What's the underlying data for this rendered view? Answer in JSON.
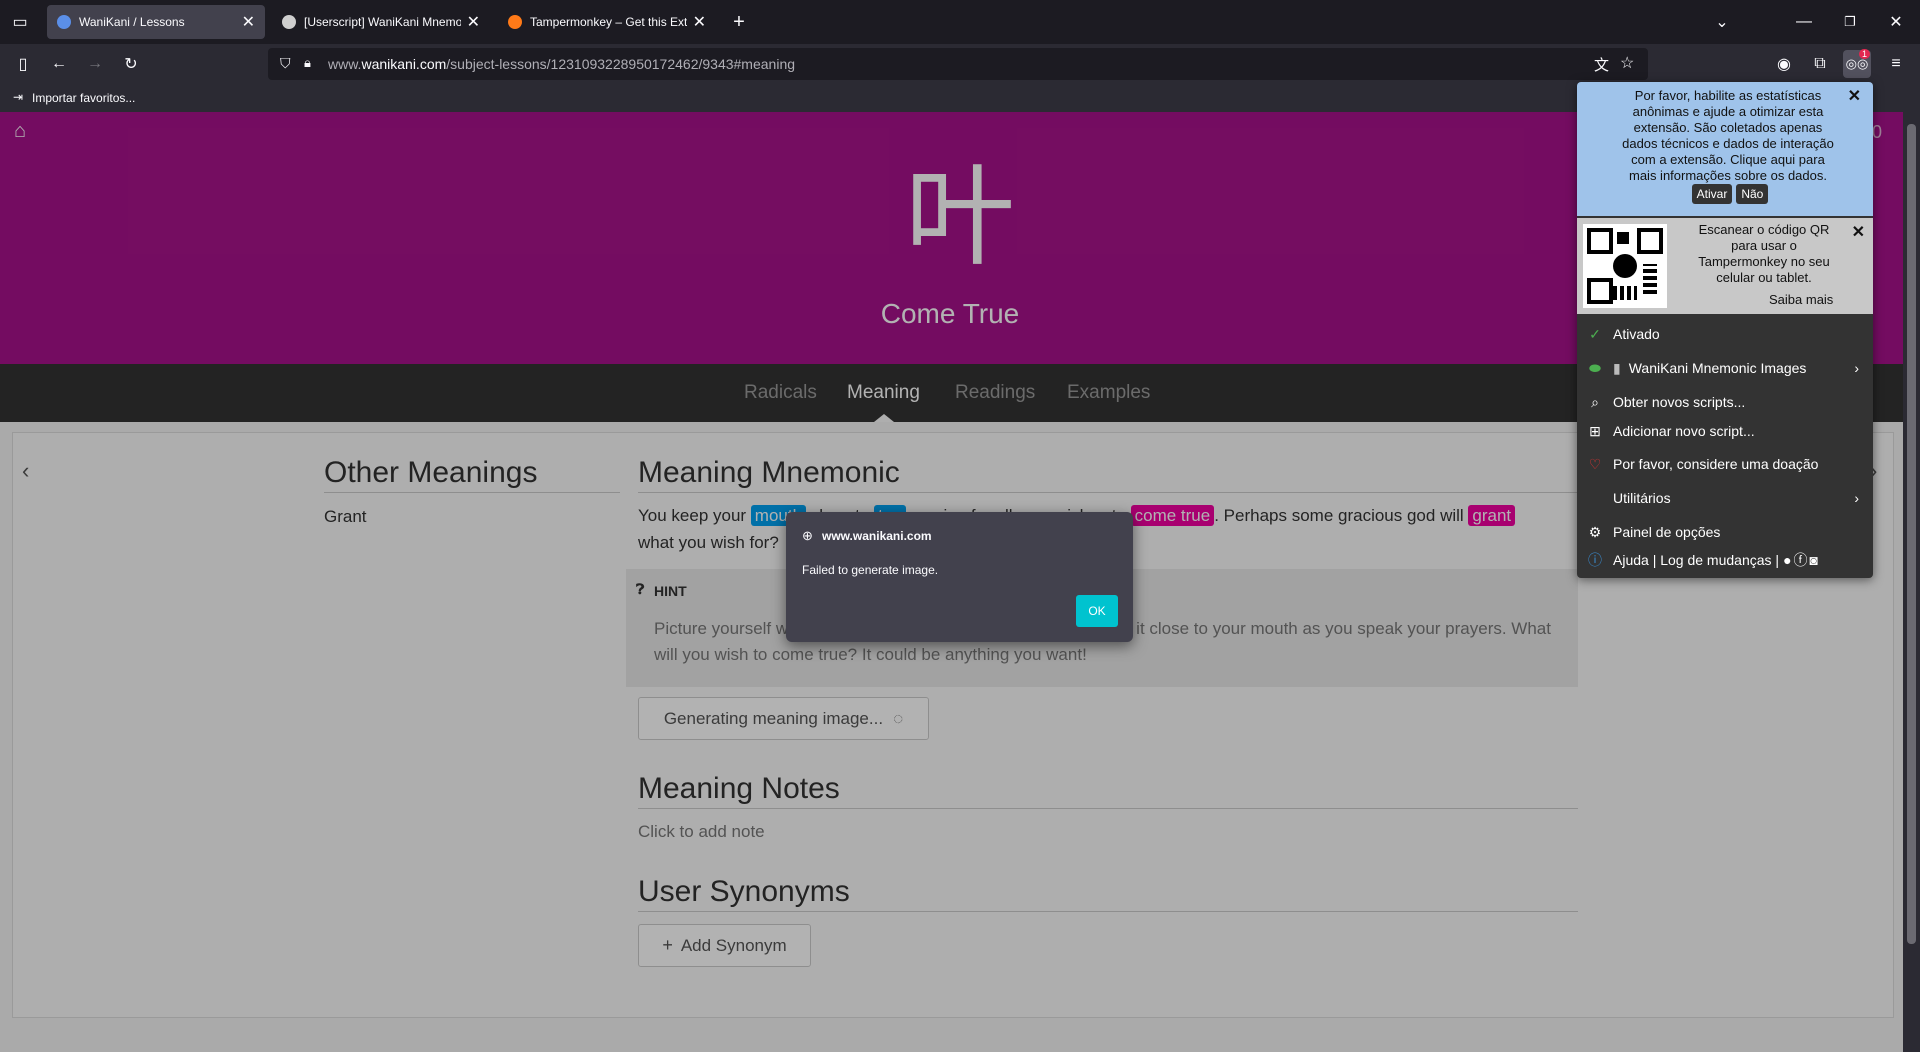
{
  "browser": {
    "tabs": [
      {
        "title": "WaniKani / Lessons",
        "active": true
      },
      {
        "title": "[Userscript] WaniKani Mnemoni",
        "active": false
      },
      {
        "title": "Tampermonkey – Get this Exten",
        "active": false
      }
    ],
    "url_prefix": "www.",
    "url_host": "wanikani.com",
    "url_path": "/subject-lessons/1231093228950172462/9343#meaning",
    "bookmark_label": "Importar favoritos..."
  },
  "page": {
    "kanji": "叶",
    "meaning": "Come True",
    "tabs": [
      "Radicals",
      "Meaning",
      "Readings",
      "Examples"
    ],
    "other_meanings_heading": "Other Meanings",
    "other_meanings_value": "Grant",
    "mnemonic_heading": "Meaning Mnemonic",
    "mnemonic_part1": "You keep your ",
    "mnemonic_hl1": "mouth",
    "mnemonic_part2": " close to ",
    "mnemonic_hl2": "ten",
    "mnemonic_part3": " praying for all your wishes to ",
    "mnemonic_hl3": "come true",
    "mnemonic_part4": ". Perhaps some gracious god will ",
    "mnemonic_hl4": "grant",
    "mnemonic_line2": "what you wish for?",
    "hint_label": "HINT",
    "hint_text_1": "Picture yourself w",
    "hint_text_1b": "g it close to your mouth as you speak your prayers. What",
    "hint_text_2": "will you wish to come true? It could be anything you want!",
    "generating_label": "Generating meaning image...",
    "notes_heading": "Meaning Notes",
    "notes_placeholder": "Click to add note",
    "synonyms_heading": "User Synonyms",
    "add_synonym_label": "Add Synonym",
    "right_edge_digit": "0"
  },
  "dialog": {
    "origin": "www.wanikani.com",
    "message": "Failed to generate image.",
    "ok_label": "OK"
  },
  "tampermonkey": {
    "badge": "1",
    "stats_text_1": "Por favor, habilite as estatísticas anônimas e ajude a otimizar esta extensão. São coletados apenas dados técnicos e dados de interação com a extensão. Clique aqui para mais informações sobre os dados.",
    "stats_activate": "Ativar",
    "stats_no": "Não",
    "qr_text": "Escanear o código QR para usar o Tampermonkey no seu celular ou tablet.",
    "qr_more": "Saiba mais",
    "enabled_label": "Ativado",
    "script_name": "WaniKani Mnemonic Images",
    "get_scripts": "Obter novos scripts...",
    "add_script": "Adicionar novo script...",
    "donate": "Por favor, considere uma doação",
    "utilities": "Utilitários",
    "options": "Painel de opções",
    "help": "Ajuda | Log de mudanças |"
  },
  "colors": {
    "wk_kanji_pink": "#a7128b",
    "radical_blue": "#00a1f1",
    "kanji_highlight": "#f100a1",
    "dialog_ok": "#00c3cf",
    "tm_stats_bg": "#9fc3ea"
  }
}
